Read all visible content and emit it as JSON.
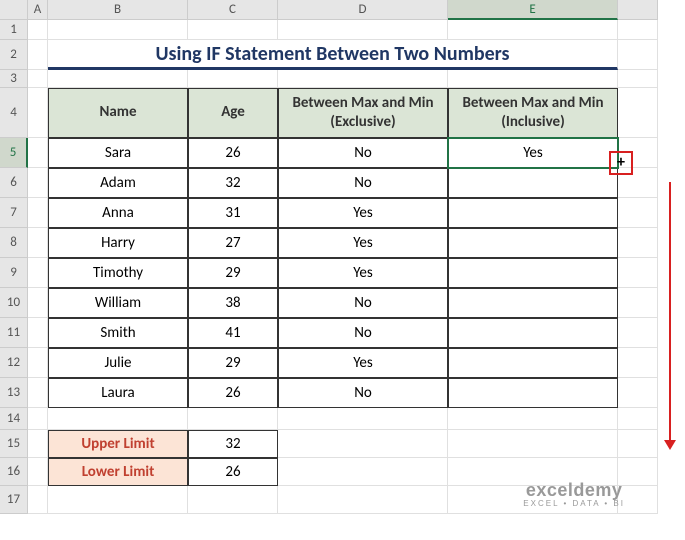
{
  "columns": [
    "A",
    "B",
    "C",
    "D",
    "E"
  ],
  "title": "Using IF Statement Between Two Numbers",
  "headers": {
    "name": "Name",
    "age": "Age",
    "exclusive": "Between Max and Min (Exclusive)",
    "inclusive": "Between Max and Min (Inclusive)"
  },
  "rows": [
    {
      "name": "Sara",
      "age": "26",
      "exclusive": "No",
      "inclusive": "Yes"
    },
    {
      "name": "Adam",
      "age": "32",
      "exclusive": "No",
      "inclusive": ""
    },
    {
      "name": "Anna",
      "age": "31",
      "exclusive": "Yes",
      "inclusive": ""
    },
    {
      "name": "Harry",
      "age": "27",
      "exclusive": "Yes",
      "inclusive": ""
    },
    {
      "name": "Timothy",
      "age": "29",
      "exclusive": "Yes",
      "inclusive": ""
    },
    {
      "name": "William",
      "age": "38",
      "exclusive": "No",
      "inclusive": ""
    },
    {
      "name": "Smith",
      "age": "41",
      "exclusive": "No",
      "inclusive": ""
    },
    {
      "name": "Julie",
      "age": "29",
      "exclusive": "Yes",
      "inclusive": ""
    },
    {
      "name": "Laura",
      "age": "26",
      "exclusive": "No",
      "inclusive": ""
    }
  ],
  "limits": {
    "upperLabel": "Upper Limit",
    "upperValue": "32",
    "lowerLabel": "Lower Limit",
    "lowerValue": "26"
  },
  "watermark": {
    "brand": "exceldemy",
    "tagline": "EXCEL • DATA • BI"
  },
  "active": {
    "col": "E",
    "row": "5"
  },
  "chart_data": {
    "type": "table",
    "title": "Using IF Statement Between Two Numbers",
    "columns": [
      "Name",
      "Age",
      "Between Max and Min (Exclusive)",
      "Between Max and Min (Inclusive)"
    ],
    "data": [
      [
        "Sara",
        26,
        "No",
        "Yes"
      ],
      [
        "Adam",
        32,
        "No",
        ""
      ],
      [
        "Anna",
        31,
        "Yes",
        ""
      ],
      [
        "Harry",
        27,
        "Yes",
        ""
      ],
      [
        "Timothy",
        29,
        "Yes",
        ""
      ],
      [
        "William",
        38,
        "No",
        ""
      ],
      [
        "Smith",
        41,
        "No",
        ""
      ],
      [
        "Julie",
        29,
        "Yes",
        ""
      ],
      [
        "Laura",
        26,
        "No",
        ""
      ]
    ],
    "parameters": {
      "Upper Limit": 32,
      "Lower Limit": 26
    }
  }
}
